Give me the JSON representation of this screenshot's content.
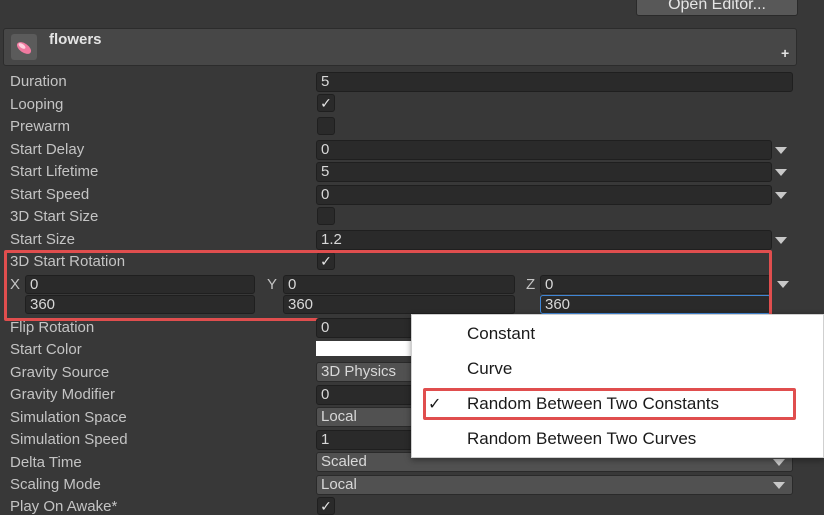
{
  "header": {
    "open_editor_label": "Open Editor...",
    "module_title": "flowers",
    "add_icon": "+"
  },
  "rows": {
    "duration": {
      "label": "Duration",
      "value": "5"
    },
    "looping": {
      "label": "Looping",
      "checked": "✓"
    },
    "prewarm": {
      "label": "Prewarm"
    },
    "start_delay": {
      "label": "Start Delay",
      "value": "0"
    },
    "start_lifetime": {
      "label": "Start Lifetime",
      "value": "5"
    },
    "start_speed": {
      "label": "Start Speed",
      "value": "0"
    },
    "start_size_3d": {
      "label": "3D Start Size"
    },
    "start_size": {
      "label": "Start Size",
      "value": "1.2"
    },
    "start_rotation_3d": {
      "label": "3D Start Rotation",
      "checked": "✓",
      "x_label": "X",
      "y_label": "Y",
      "z_label": "Z",
      "x_min": "0",
      "y_min": "0",
      "z_min": "0",
      "x_max": "360",
      "y_max": "360",
      "z_max": "360"
    },
    "flip_rotation": {
      "label": "Flip Rotation",
      "value": "0"
    },
    "start_color": {
      "label": "Start Color",
      "color": "#ffffff"
    },
    "gravity_source": {
      "label": "Gravity Source",
      "value": "3D Physics"
    },
    "gravity_modifier": {
      "label": "Gravity Modifier",
      "value": "0"
    },
    "simulation_space": {
      "label": "Simulation Space",
      "value": "Local"
    },
    "simulation_speed": {
      "label": "Simulation Speed",
      "value": "1"
    },
    "delta_time": {
      "label": "Delta Time",
      "value": "Scaled"
    },
    "scaling_mode": {
      "label": "Scaling Mode",
      "value": "Local"
    },
    "play_on_awake": {
      "label": "Play On Awake*",
      "checked": "✓"
    }
  },
  "popup_menu": {
    "items": [
      "Constant",
      "Curve",
      "Random Between Two Constants",
      "Random Between Two Curves"
    ],
    "selected_mark": "✓"
  },
  "colors": {
    "highlight": "#e04e4e",
    "focus": "#3f86d6"
  }
}
